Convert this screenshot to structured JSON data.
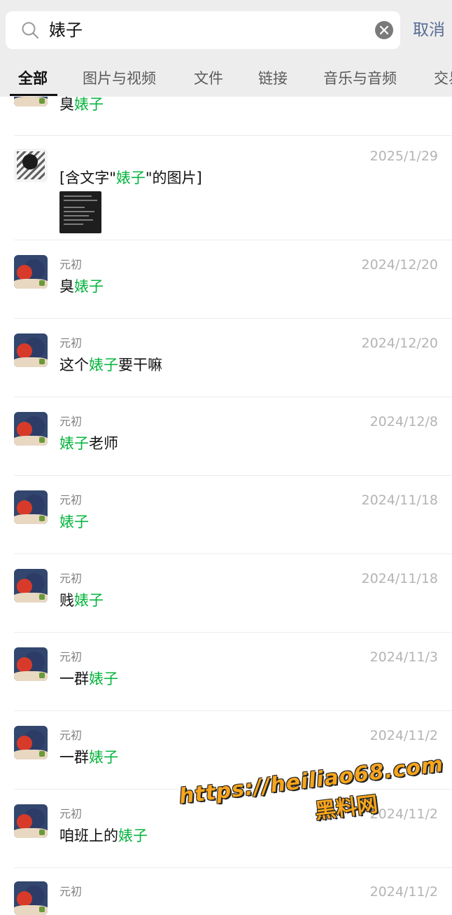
{
  "search": {
    "query": "婊子",
    "cancel_label": "取消"
  },
  "tabs": [
    "全部",
    "图片与视频",
    "文件",
    "链接",
    "音乐与音频",
    "交易"
  ],
  "active_tab": "全部",
  "results": [
    {
      "sender": "",
      "date": "",
      "pre": "臭",
      "hl": "婊子",
      "post": ""
    },
    {
      "sender": "",
      "date": "2025/1/29",
      "pre": "[含文字\"",
      "hl": "婊子",
      "post": "\"的图片]"
    },
    {
      "sender": "元初",
      "date": "2024/12/20",
      "pre": "臭",
      "hl": "婊子",
      "post": ""
    },
    {
      "sender": "元初",
      "date": "2024/12/20",
      "pre": "这个",
      "hl": "婊子",
      "post": "要干嘛"
    },
    {
      "sender": "元初",
      "date": "2024/12/8",
      "pre": "",
      "hl": "婊子",
      "post": "老师"
    },
    {
      "sender": "元初",
      "date": "2024/11/18",
      "pre": "",
      "hl": "婊子",
      "post": ""
    },
    {
      "sender": "元初",
      "date": "2024/11/18",
      "pre": "贱",
      "hl": "婊子",
      "post": ""
    },
    {
      "sender": "元初",
      "date": "2024/11/3",
      "pre": "一群",
      "hl": "婊子",
      "post": ""
    },
    {
      "sender": "元初",
      "date": "2024/11/2",
      "pre": "一群",
      "hl": "婊子",
      "post": ""
    },
    {
      "sender": "元初",
      "date": "2024/11/2",
      "pre": "咱班上的",
      "hl": "婊子",
      "post": ""
    },
    {
      "sender": "元初",
      "date": "2024/11/2",
      "pre": "",
      "hl": "",
      "post": ""
    }
  ],
  "watermark": {
    "url": "https://heiliao68.com",
    "name": "黑料网"
  },
  "colors": {
    "highlight": "#07b53f",
    "cancel": "#576b95",
    "topbar_bg": "#ededed"
  }
}
